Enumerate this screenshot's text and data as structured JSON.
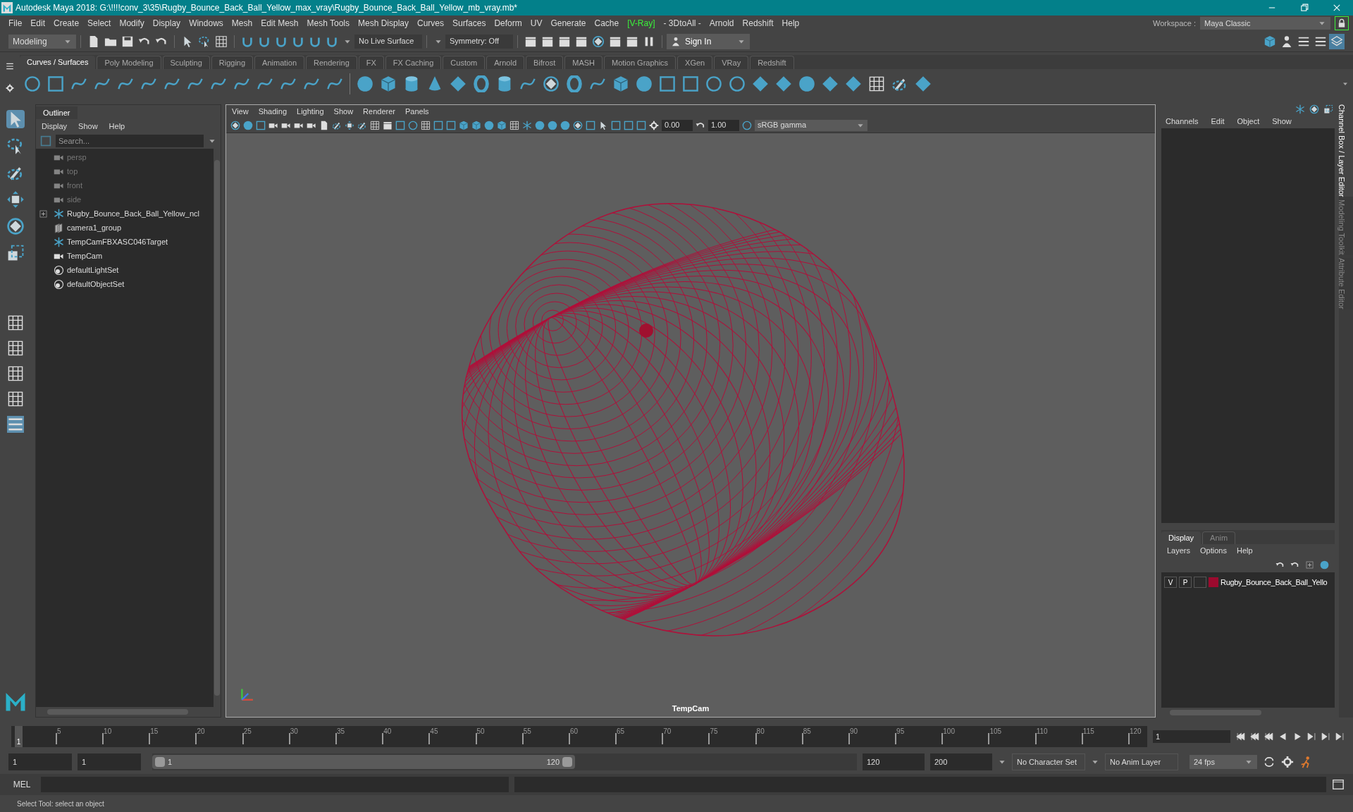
{
  "window": {
    "title": "Autodesk Maya 2018: G:\\!!!!conv_3\\35\\Rugby_Bounce_Back_Ball_Yellow_max_vray\\Rugby_Bounce_Back_Ball_Yellow_mb_vray.mb*"
  },
  "menu_bar": [
    {
      "label": "File",
      "highlighted": false
    },
    {
      "label": "Edit",
      "highlighted": false
    },
    {
      "label": "Create",
      "highlighted": false
    },
    {
      "label": "Select",
      "highlighted": false
    },
    {
      "label": "Modify",
      "highlighted": false
    },
    {
      "label": "Display",
      "highlighted": false
    },
    {
      "label": "Windows",
      "highlighted": false
    },
    {
      "label": "Mesh",
      "highlighted": false
    },
    {
      "label": "Edit Mesh",
      "highlighted": false
    },
    {
      "label": "Mesh Tools",
      "highlighted": false
    },
    {
      "label": "Mesh Display",
      "highlighted": false
    },
    {
      "label": "Curves",
      "highlighted": false
    },
    {
      "label": "Surfaces",
      "highlighted": false
    },
    {
      "label": "Deform",
      "highlighted": false
    },
    {
      "label": "UV",
      "highlighted": false
    },
    {
      "label": "Generate",
      "highlighted": false
    },
    {
      "label": "Cache",
      "highlighted": false
    },
    {
      "label": "[V-Ray]",
      "highlighted": true
    },
    {
      "label": "- 3DtoAll -",
      "highlighted": false
    },
    {
      "label": "Arnold",
      "highlighted": false
    },
    {
      "label": "Redshift",
      "highlighted": false
    },
    {
      "label": "Help",
      "highlighted": false
    }
  ],
  "status_line": {
    "mode": "Modeling",
    "live_surface": "No Live Surface",
    "symmetry": "Symmetry: Off",
    "sign_in": "Sign In",
    "workspace_label": "Workspace :",
    "workspace": "Maya Classic"
  },
  "shelf": {
    "tabs": [
      {
        "label": "Curves / Surfaces",
        "selected": true
      },
      {
        "label": "Poly Modeling",
        "selected": false
      },
      {
        "label": "Sculpting",
        "selected": false
      },
      {
        "label": "Rigging",
        "selected": false
      },
      {
        "label": "Animation",
        "selected": false
      },
      {
        "label": "Rendering",
        "selected": false
      },
      {
        "label": "FX",
        "selected": false
      },
      {
        "label": "FX Caching",
        "selected": false
      },
      {
        "label": "Custom",
        "selected": false
      },
      {
        "label": "Arnold",
        "selected": false
      },
      {
        "label": "Bifrost",
        "selected": false
      },
      {
        "label": "MASH",
        "selected": false
      },
      {
        "label": "Motion Graphics",
        "selected": false
      },
      {
        "label": "XGen",
        "selected": false
      },
      {
        "label": "VRay",
        "selected": false
      },
      {
        "label": "Redshift",
        "selected": false
      }
    ]
  },
  "outliner": {
    "title": "Outliner",
    "menus": [
      "Display",
      "Show",
      "Help"
    ],
    "search": {
      "placeholder": "Search..."
    },
    "items": [
      {
        "label": "persp",
        "kind": "camera",
        "dimmed": true
      },
      {
        "label": "top",
        "kind": "camera",
        "dimmed": true
      },
      {
        "label": "front",
        "kind": "camera",
        "dimmed": true
      },
      {
        "label": "side",
        "kind": "camera",
        "dimmed": true
      },
      {
        "label": "Rugby_Bounce_Back_Ball_Yellow_ncl",
        "kind": "transform",
        "dimmed": false,
        "expanded": false
      },
      {
        "label": "camera1_group",
        "kind": "group",
        "dimmed": false
      },
      {
        "label": "TempCamFBXASC046Target",
        "kind": "transform",
        "dimmed": false
      },
      {
        "label": "TempCam",
        "kind": "camera",
        "dimmed": false
      },
      {
        "label": "defaultLightSet",
        "kind": "set",
        "dimmed": false
      },
      {
        "label": "defaultObjectSet",
        "kind": "set",
        "dimmed": false
      }
    ]
  },
  "viewport": {
    "menus": [
      "View",
      "Shading",
      "Lighting",
      "Show",
      "Renderer",
      "Panels"
    ],
    "exposure": "0.00",
    "gamma": "1.00",
    "color_space": "sRGB gamma",
    "camera": "TempCam"
  },
  "channel_box": {
    "menus": [
      "Channels",
      "Edit",
      "Object",
      "Show"
    ]
  },
  "layer_editor": {
    "tabs": [
      {
        "label": "Display",
        "selected": true
      },
      {
        "label": "Anim",
        "selected": false
      }
    ],
    "menus": [
      "Layers",
      "Options",
      "Help"
    ],
    "layers": [
      {
        "visible": "V",
        "playback": "P",
        "color": "#9b0a2e",
        "name": "Rugby_Bounce_Back_Ball_Yello"
      }
    ]
  },
  "side_tabs": [
    {
      "label": "Channel Box / Layer Editor",
      "selected": true
    },
    {
      "label": "Modeling Toolkit",
      "selected": false
    },
    {
      "label": "Attribute Editor",
      "selected": false
    }
  ],
  "timeline": {
    "ticks": [
      "5",
      "10",
      "15",
      "20",
      "25",
      "30",
      "35",
      "40",
      "45",
      "50",
      "55",
      "60",
      "65",
      "70",
      "75",
      "80",
      "85",
      "90",
      "95",
      "100",
      "105",
      "110",
      "115",
      "120"
    ],
    "current_frame": "1",
    "frame_field": "1"
  },
  "range": {
    "level": 0.6,
    "start_outer": "1",
    "start": "1",
    "slider_start": "1",
    "slider_end": "120",
    "end": "120",
    "end_outer": "200"
  },
  "character_set": "No Character Set",
  "anim_layer": "No Anim Layer",
  "fps": "24 fps",
  "command_line": {
    "language": "MEL"
  },
  "help_line": "Select Tool: select an object"
}
